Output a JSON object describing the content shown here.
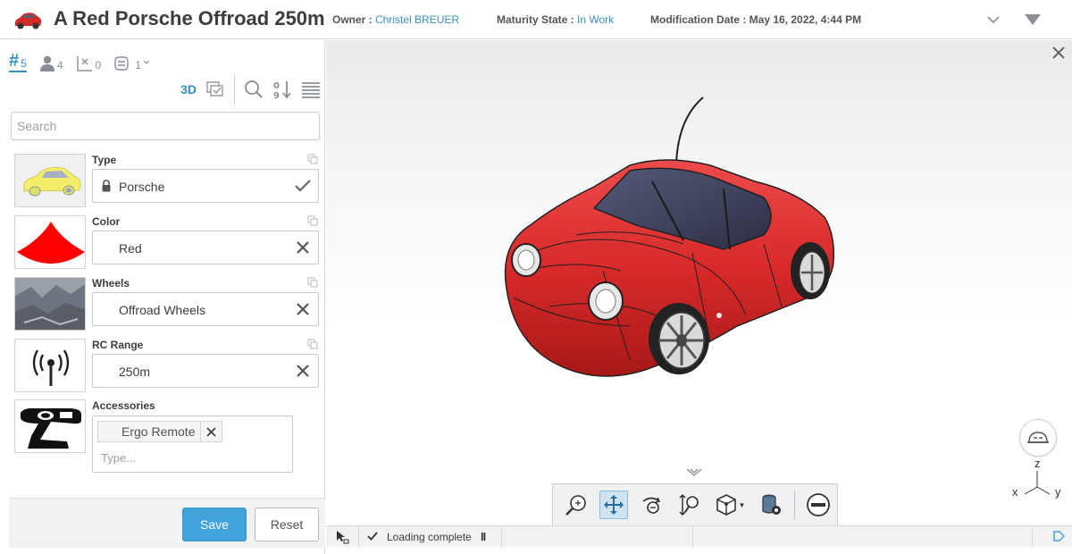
{
  "header": {
    "title": "A Red Porsche Offroad 250m",
    "owner_label": "Owner : ",
    "owner_value": "Christel BREUER",
    "maturity_label": "Maturity State : ",
    "maturity_value": "In Work",
    "moddate_label": "Modification Date : ",
    "moddate_value": "May 16, 2022, 4:44 PM"
  },
  "tabs": [
    {
      "icon": "hash-icon",
      "glyph": "#",
      "count": "5",
      "active": true
    },
    {
      "icon": "person-icon",
      "count": "4",
      "active": false
    },
    {
      "icon": "checkbox-x-icon",
      "count": "0",
      "active": false
    },
    {
      "icon": "stack-icon",
      "count": "1",
      "active": false
    }
  ],
  "toolbar": {
    "three_d_label": "3D"
  },
  "search": {
    "placeholder": "Search"
  },
  "attributes": [
    {
      "label": "Type",
      "value": "Porsche",
      "locked": true,
      "action": "check"
    },
    {
      "label": "Color",
      "value": "Red",
      "locked": false,
      "action": "clear"
    },
    {
      "label": "Wheels",
      "value": "Offroad Wheels",
      "locked": false,
      "action": "clear"
    },
    {
      "label": "RC Range",
      "value": "250m",
      "locked": false,
      "action": "clear"
    }
  ],
  "accessories": {
    "label": "Accessories",
    "chips": [
      "Ergo Remote"
    ],
    "input_placeholder": "Type..."
  },
  "footer": {
    "save_label": "Save",
    "reset_label": "Reset"
  },
  "viewer": {
    "axis_z": "z",
    "axis_x": "x",
    "axis_y": "y",
    "controls": [
      "zoom-fit-icon",
      "pan-icon",
      "rotate-icon",
      "zoom-icon",
      "view-cube-icon",
      "database-settings-icon",
      "section-icon"
    ]
  },
  "status": {
    "text": "Loading complete",
    "pause_glyph": "II"
  },
  "colors": {
    "accent": "#368ec4",
    "save_button": "#42a2da",
    "car_red": "#d8282c"
  }
}
